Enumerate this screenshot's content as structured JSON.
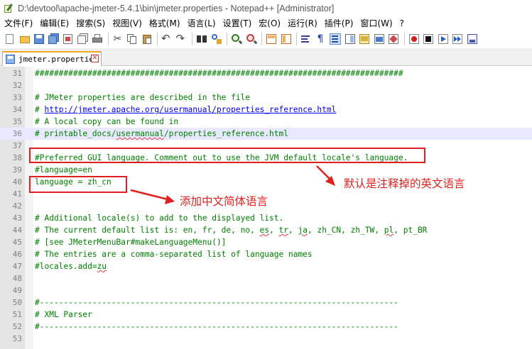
{
  "window": {
    "title": "D:\\devtool\\apache-jmeter-5.4.1\\bin\\jmeter.properties - Notepad++ [Administrator]"
  },
  "menu": [
    {
      "label": "文件(F)",
      "key": "file"
    },
    {
      "label": "编辑(E)",
      "key": "edit"
    },
    {
      "label": "搜索(S)",
      "key": "search"
    },
    {
      "label": "视图(V)",
      "key": "view"
    },
    {
      "label": "格式(M)",
      "key": "format"
    },
    {
      "label": "语言(L)",
      "key": "language"
    },
    {
      "label": "设置(T)",
      "key": "settings"
    },
    {
      "label": "宏(O)",
      "key": "macro"
    },
    {
      "label": "运行(R)",
      "key": "run"
    },
    {
      "label": "插件(P)",
      "key": "plugins"
    },
    {
      "label": "窗口(W)",
      "key": "window"
    },
    {
      "label": "?",
      "key": "help"
    }
  ],
  "toolbar_icons": [
    "new-file-icon",
    "open-file-icon",
    "save-icon",
    "save-all-icon",
    "close-icon",
    "close-all-icon",
    "print-icon",
    "|",
    "cut-icon",
    "copy-icon",
    "paste-icon",
    "|",
    "undo-icon",
    "redo-icon",
    "|",
    "find-icon",
    "replace-icon",
    "|",
    "zoom-in-icon",
    "zoom-out-icon",
    "|",
    "sync-vertical-icon",
    "sync-horizontal-icon",
    "|",
    "word-wrap-icon",
    "show-all-chars-icon",
    "indent-guide-icon",
    "doc-map-icon",
    "function-list-icon",
    "folder-workspace-icon",
    "monitoring-icon",
    "|",
    "record-macro-icon",
    "stop-macro-icon",
    "play-macro-icon",
    "run-macro-multiple-icon",
    "save-macro-icon"
  ],
  "tab": {
    "label": "jmeter.properties",
    "close": "✕"
  },
  "editor": {
    "lines": [
      {
        "n": "31",
        "text": "#############################################################################"
      },
      {
        "n": "32",
        "text": ""
      },
      {
        "n": "33",
        "text": "# JMeter properties are described in the file"
      },
      {
        "n": "34",
        "pre": "# ",
        "link": "http://jmeter.apache.org/usermanual/properties_reference.html"
      },
      {
        "n": "35",
        "text": "# A local copy can be found in"
      },
      {
        "n": "36",
        "pre": "# printable_docs/",
        "sq": "usermanual",
        "post": "/properties_reference.html",
        "current": true
      },
      {
        "n": "37",
        "text": ""
      },
      {
        "n": "38",
        "text": "#Preferred GUI language. Comment out to use the JVM default locale's language."
      },
      {
        "n": "39",
        "text": "#language=en"
      },
      {
        "n": "40",
        "text": "language = zh_cn"
      },
      {
        "n": "41",
        "text": ""
      },
      {
        "n": "42",
        "text": ""
      },
      {
        "n": "43",
        "text": "# Additional locale(s) to add to the displayed list."
      },
      {
        "n": "44",
        "segs": [
          [
            "# The current default list is: en, fr, de, no, ",
            ""
          ],
          [
            "es",
            "sq"
          ],
          [
            ", ",
            ""
          ],
          [
            "tr",
            "sq"
          ],
          [
            ", ",
            ""
          ],
          [
            "ja",
            "sq"
          ],
          [
            ", zh_CN, zh_TW, ",
            ""
          ],
          [
            "pl",
            "sq"
          ],
          [
            ", pt_BR",
            ""
          ]
        ]
      },
      {
        "n": "45",
        "text": "# [see JMeterMenuBar#makeLanguageMenu()]"
      },
      {
        "n": "46",
        "text": "# The entries are a comma-separated list of language names"
      },
      {
        "n": "47",
        "segs": [
          [
            "#locales.add=",
            ""
          ],
          [
            "zu",
            "sq"
          ]
        ]
      },
      {
        "n": "48",
        "text": ""
      },
      {
        "n": "49",
        "text": ""
      },
      {
        "n": "50",
        "text": "#---------------------------------------------------------------------------"
      },
      {
        "n": "51",
        "text": "# XML Parser"
      },
      {
        "n": "52",
        "text": "#---------------------------------------------------------------------------"
      },
      {
        "n": "53",
        "text": ""
      }
    ]
  },
  "annotations": {
    "note_default": "默认是注释掉的英文语言",
    "note_add": "添加中文简体语言"
  },
  "colors": {
    "comment": "#008000",
    "link": "#0000ff",
    "annotation": "#e02020",
    "current_line": "#e8e8ff"
  }
}
